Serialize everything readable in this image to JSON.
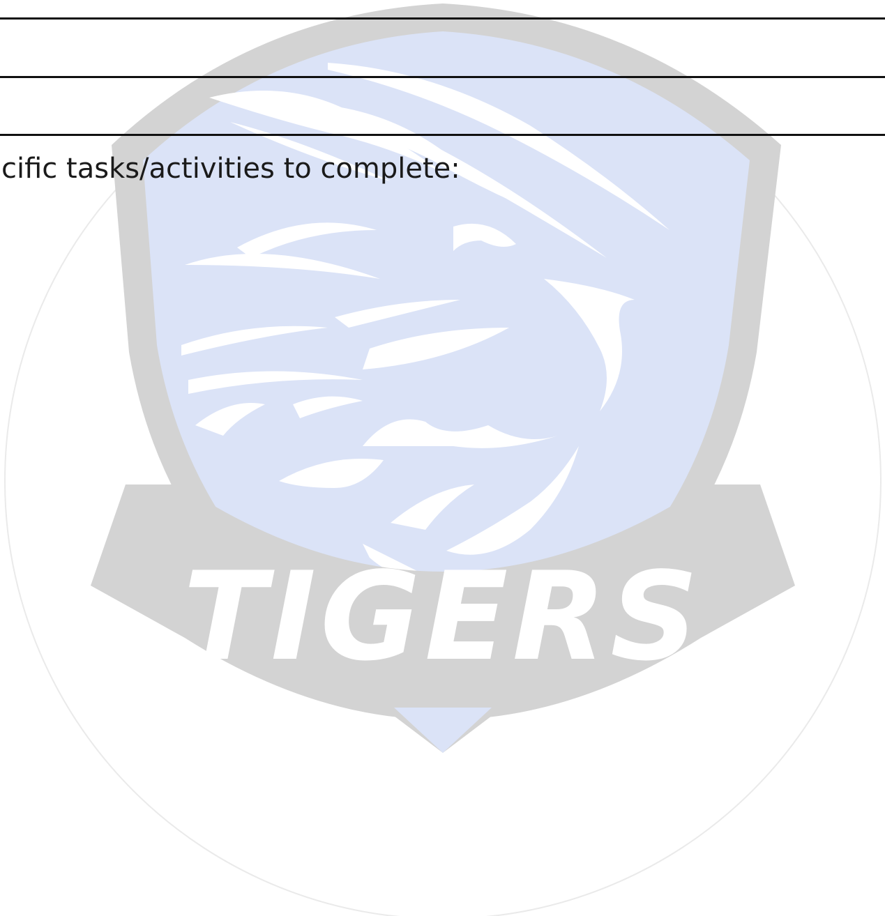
{
  "document": {
    "prompt_text": "cific tasks/activities to complete:"
  },
  "watermark": {
    "icon": "tigers-crest-logo",
    "text": "TIGERS",
    "colors": {
      "shield_fill": "#dbe3f7",
      "banner_fill": "#d3d3d3",
      "outer_ring": "#eaeaea"
    }
  }
}
